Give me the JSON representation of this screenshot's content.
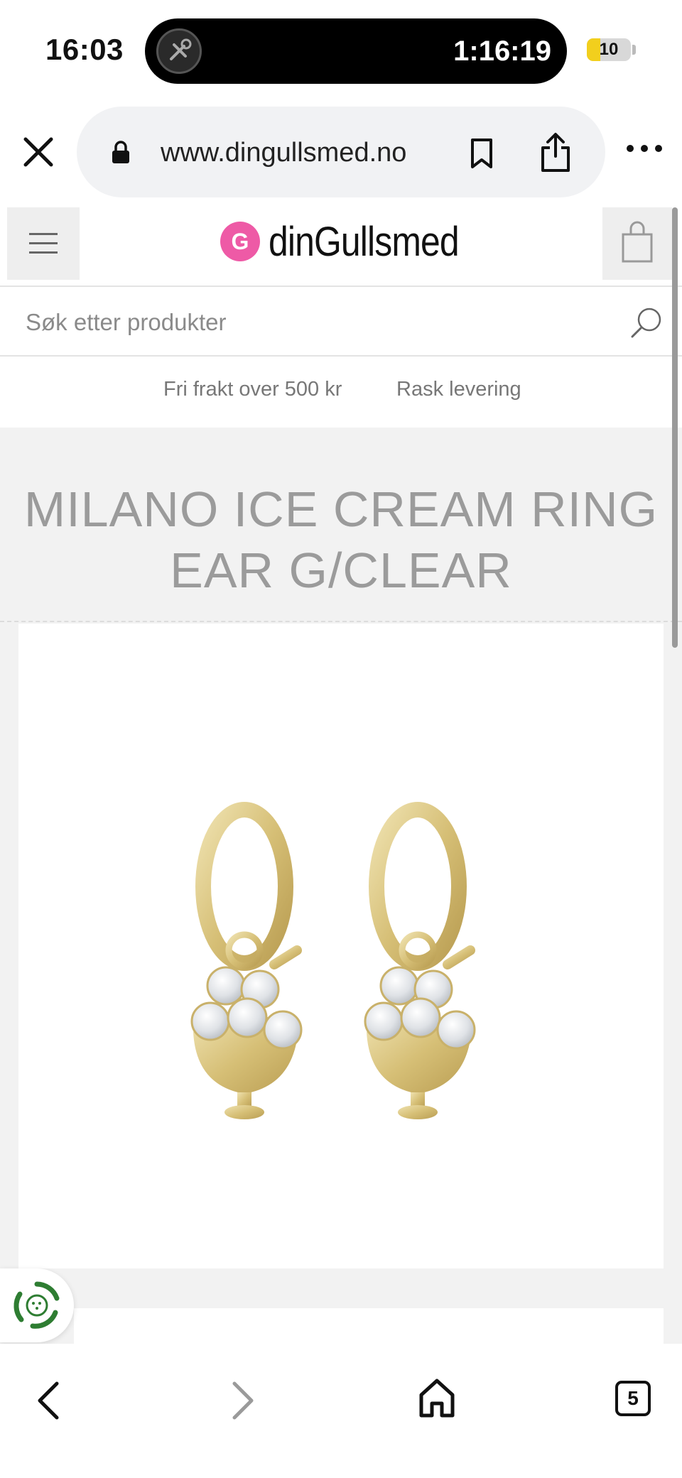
{
  "status_bar": {
    "time": "16:03",
    "activity_timer": "1:16:19",
    "battery_level": "10",
    "battery_fraction": 0.1
  },
  "browser": {
    "url": "www.dingullsmed.no",
    "tabs_count": "5"
  },
  "site": {
    "logo_letter": "G",
    "logo_text": "dinGullsmed",
    "search_placeholder": "Søk etter produkter",
    "usp": [
      "Fri frakt over 500 kr",
      "Rask levering"
    ]
  },
  "product": {
    "title": "MILANO ICE CREAM RING EAR G/CLEAR"
  },
  "colors": {
    "logo_pink": "#ee5aa6",
    "gold": "#d8c27a",
    "eco_green": "#2e7d32",
    "title_gray": "#9b9b9b"
  },
  "icons": {
    "close": "close-icon",
    "lock": "lock-icon",
    "bookmark": "bookmark-icon",
    "share": "share-icon",
    "more": "more-icon",
    "menu": "hamburger-icon",
    "cart": "shopping-bag-icon",
    "search": "search-icon",
    "eco": "recycle-icon",
    "back": "chevron-left-icon",
    "forward": "chevron-right-icon",
    "home": "home-icon"
  }
}
